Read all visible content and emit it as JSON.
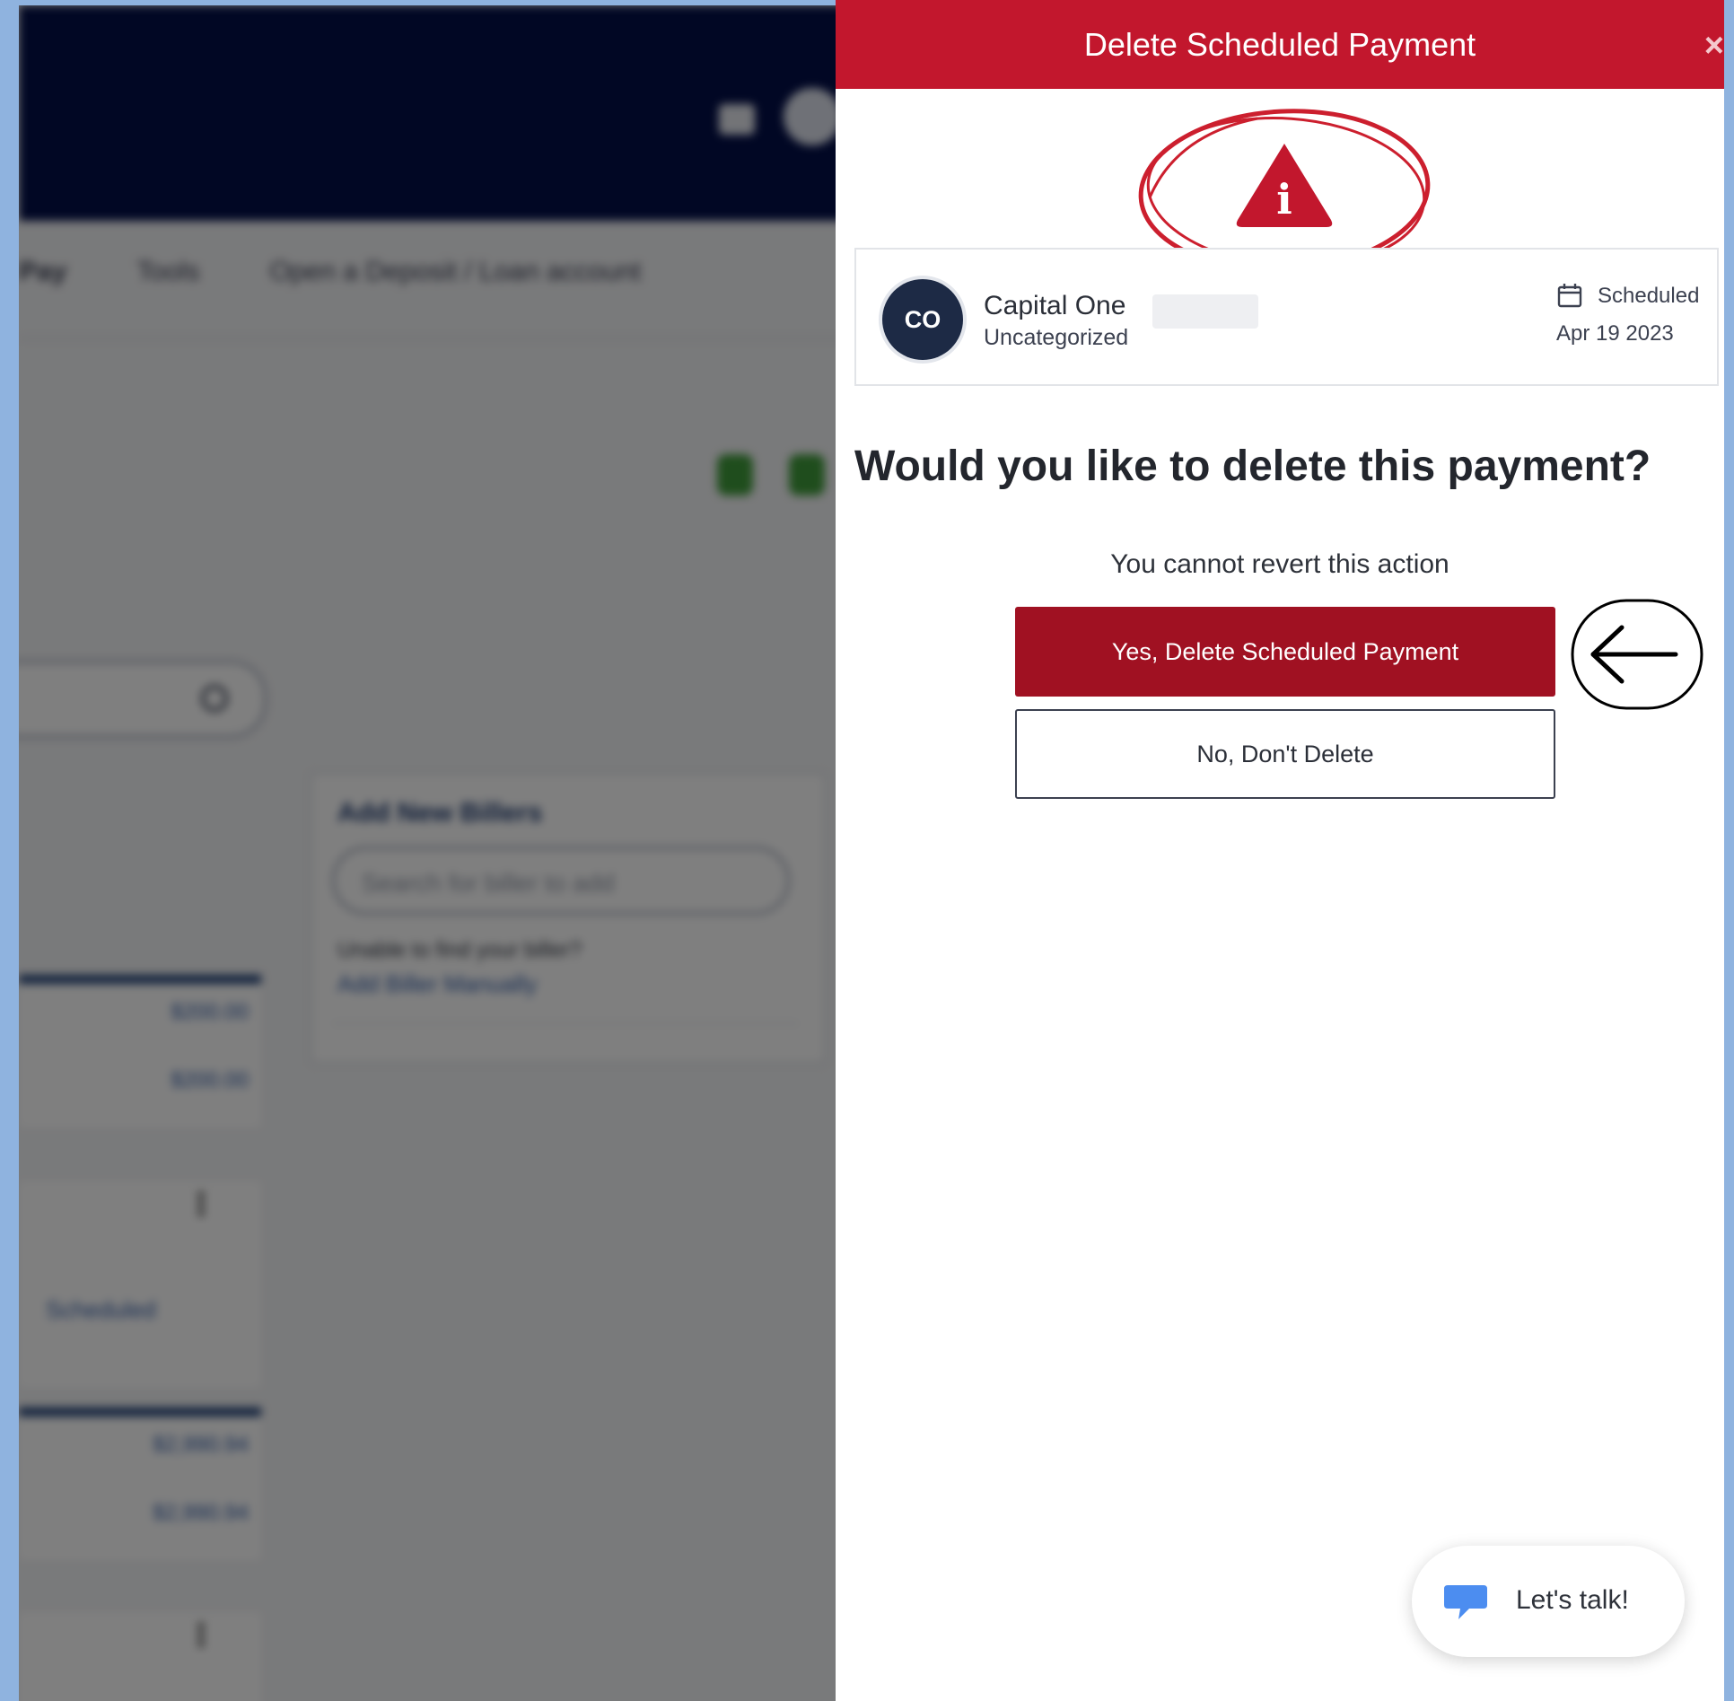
{
  "background_app": {
    "nav_items": [
      "Pay",
      "Tools",
      "Open a Deposit / Loan account"
    ],
    "add_billers_title": "Add New Billers",
    "biller_search_placeholder": "Search for biller to add",
    "unable_text": "Unable to find your biller?",
    "add_manually_link": "Add Biller Manually",
    "amounts": [
      "$200.00",
      "$200.00",
      "$2,990.94",
      "$2,990.94"
    ],
    "scheduled_label": "Scheduled"
  },
  "modal": {
    "title": "Delete Scheduled Payment",
    "close_glyph": "×",
    "warning_icon_glyph": "i",
    "payment": {
      "avatar_initials": "CO",
      "payee_name": "Capital One",
      "category": "Uncategorized",
      "status": "Scheduled",
      "date": "Apr 19 2023"
    },
    "question": "Would you like to delete this payment?",
    "subtext": "You cannot revert this action",
    "confirm_label": "Yes, Delete Scheduled Payment",
    "cancel_label": "No, Don't Delete"
  },
  "chat": {
    "label": "Let's talk!"
  },
  "colors": {
    "header_red": "#c2172d",
    "confirm_red": "#a01122",
    "navy": "#020e48",
    "annotation_red": "#cc1f2e",
    "page_border": "#8fb3df"
  }
}
